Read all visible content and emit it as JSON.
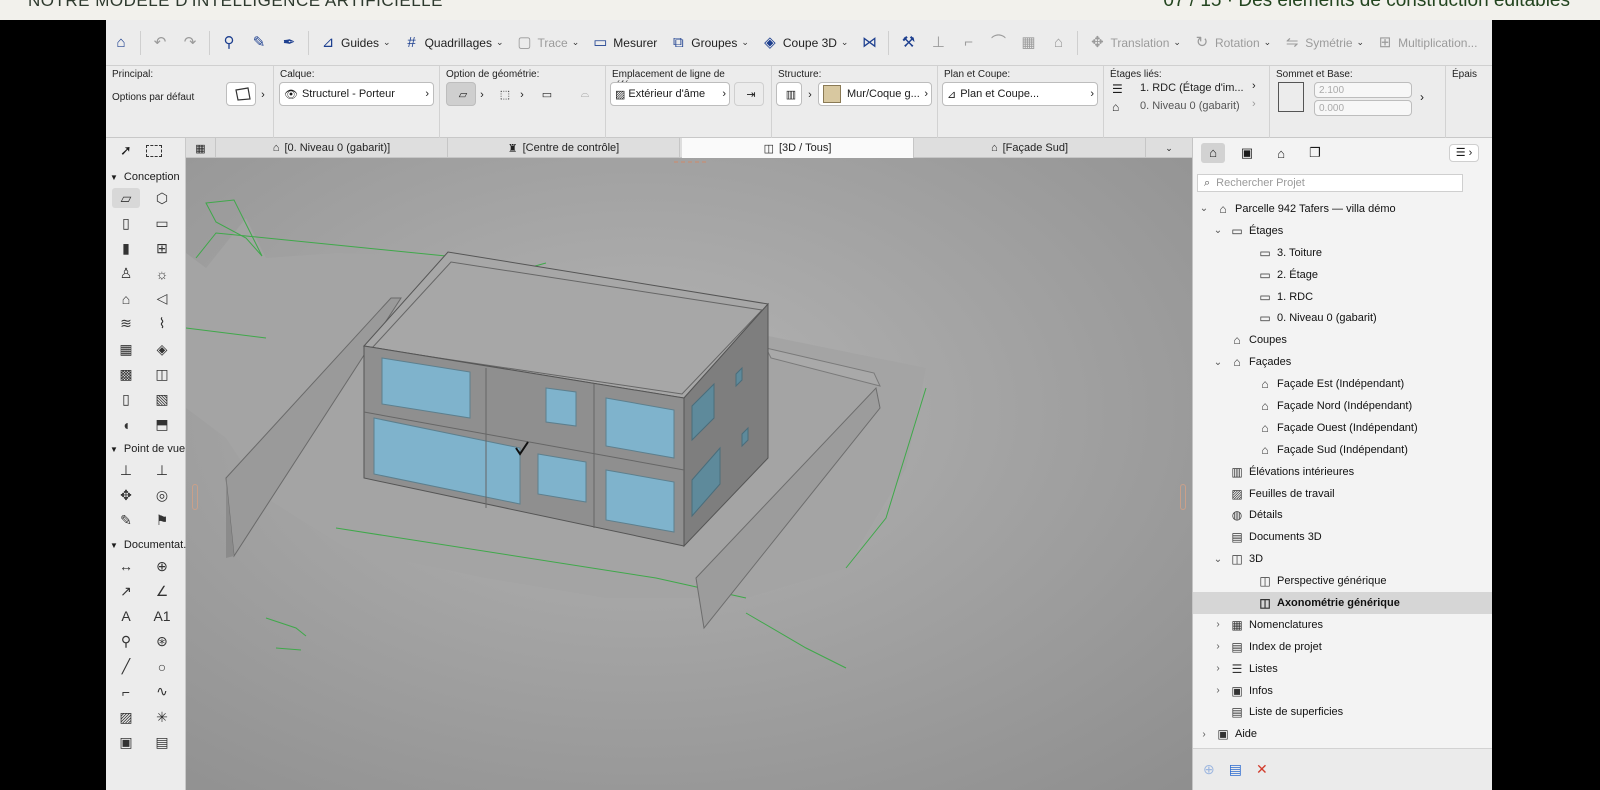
{
  "slide_header": {
    "left_text": "NOTRE MODÈLE D'INTELLIGENCE ARTIFICIELLE",
    "right_text": "07 / 15 · Des éléments de construction éditables"
  },
  "toolbar": {
    "items": [
      {
        "icon": "home-icon",
        "label": ""
      },
      {
        "icon": "undo-icon",
        "label": "",
        "dim": true
      },
      {
        "icon": "redo-icon",
        "label": "",
        "dim": true
      },
      {
        "icon": "inject-icon",
        "label": ""
      },
      {
        "icon": "pipette-icon",
        "label": ""
      },
      {
        "icon": "syringe-icon",
        "label": ""
      },
      {
        "icon": "guides-icon",
        "label": "Guides",
        "caret": true
      },
      {
        "icon": "grid-icon",
        "label": "Quadrillages",
        "caret": true
      },
      {
        "icon": "trace-icon",
        "label": "Trace",
        "caret": true,
        "dim": true
      },
      {
        "icon": "ruler-icon",
        "label": "Mesurer"
      },
      {
        "icon": "groups-icon",
        "label": "Groupes",
        "caret": true
      },
      {
        "icon": "cut3d-icon",
        "label": "Coupe 3D",
        "caret": true
      },
      {
        "icon": "split-icon",
        "label": ""
      },
      {
        "icon": "hammer-icon",
        "label": ""
      },
      {
        "icon": "adjust-icon",
        "label": "",
        "dim": true
      },
      {
        "icon": "intersect-icon",
        "label": "",
        "dim": true
      },
      {
        "icon": "fillet-icon",
        "label": "",
        "dim": true
      },
      {
        "icon": "explode-icon",
        "label": "",
        "dim": true
      },
      {
        "icon": "roof-icon",
        "label": "",
        "dim": true
      },
      {
        "icon": "translation-icon",
        "label": "Translation",
        "caret": true,
        "dim": true
      },
      {
        "icon": "rotation-icon",
        "label": "Rotation",
        "caret": true,
        "dim": true
      },
      {
        "icon": "mirror-icon",
        "label": "Symétrie",
        "caret": true,
        "dim": true
      },
      {
        "icon": "multiply-icon",
        "label": "Multiplication...",
        "dim": true
      }
    ]
  },
  "infobox": {
    "principal": {
      "title": "Principal:",
      "value": "Options par défaut"
    },
    "calque": {
      "title": "Calque:",
      "value": "Structurel - Porteur"
    },
    "geometrie": {
      "title": "Option de géométrie:"
    },
    "ligne_ref": {
      "title": "Emplacement de ligne de référence:",
      "value": "Extérieur d'âme"
    },
    "structure": {
      "title": "Structure:",
      "value": "Mur/Coque g..."
    },
    "plan_coupe": {
      "title": "Plan et Coupe:",
      "value": "Plan et Coupe..."
    },
    "etages": {
      "title": "Étages liés:",
      "top": "1. RDC (Étage d'im...",
      "bottom": "0. Niveau 0 (gabarit)"
    },
    "sommet": {
      "title": "Sommet et Base:",
      "top": "2.100",
      "bottom": "0.000"
    },
    "epaisseur": {
      "title": "Épais"
    }
  },
  "tabs": [
    {
      "icon": "floorplan-icon",
      "label": "[0. Niveau 0 (gabarit)]"
    },
    {
      "icon": "control-center-icon",
      "label": "[Centre de contrôle]"
    },
    {
      "icon": "3d-cube-icon",
      "label": "[3D / Tous]",
      "active": true
    },
    {
      "icon": "elevation-icon",
      "label": "[Façade Sud]"
    }
  ],
  "toolbox": {
    "sections": [
      {
        "label": "Conception"
      },
      {
        "label": "Point de vue"
      },
      {
        "label": "Documentat."
      }
    ]
  },
  "navigator": {
    "search_placeholder": "Rechercher Projet",
    "tree": [
      {
        "label": "Parcelle 942 Tafers — villa démo",
        "level": 0,
        "tw": "v",
        "icon": "house-icon"
      },
      {
        "label": "Étages",
        "level": 1,
        "tw": "v",
        "icon": "stories-icon"
      },
      {
        "label": "3. Toiture",
        "level": 2,
        "tw": "",
        "icon": "story-icon"
      },
      {
        "label": "2. Étage",
        "level": 2,
        "tw": "",
        "icon": "story-icon"
      },
      {
        "label": "1. RDC",
        "level": 2,
        "tw": "",
        "icon": "story-icon"
      },
      {
        "label": "0. Niveau 0 (gabarit)",
        "level": 2,
        "tw": "",
        "icon": "story-icon"
      },
      {
        "label": "Coupes",
        "level": 1,
        "tw": "",
        "icon": "section-icon"
      },
      {
        "label": "Façades",
        "level": 1,
        "tw": "v",
        "icon": "elevation-icon"
      },
      {
        "label": "Façade Est (Indépendant)",
        "level": 2,
        "tw": "",
        "icon": "elevation-icon"
      },
      {
        "label": "Façade Nord (Indépendant)",
        "level": 2,
        "tw": "",
        "icon": "elevation-icon"
      },
      {
        "label": "Façade Ouest (Indépendant)",
        "level": 2,
        "tw": "",
        "icon": "elevation-icon"
      },
      {
        "label": "Façade Sud (Indépendant)",
        "level": 2,
        "tw": "",
        "icon": "elevation-icon"
      },
      {
        "label": "Élévations intérieures",
        "level": 1,
        "tw": "",
        "icon": "interior-elevation-icon"
      },
      {
        "label": "Feuilles de travail",
        "level": 1,
        "tw": "",
        "icon": "worksheet-icon"
      },
      {
        "label": "Détails",
        "level": 1,
        "tw": "",
        "icon": "detail-icon"
      },
      {
        "label": "Documents 3D",
        "level": 1,
        "tw": "",
        "icon": "document-3d-icon"
      },
      {
        "label": "3D",
        "level": 1,
        "tw": "v",
        "icon": "3d-icon"
      },
      {
        "label": "Perspective générique",
        "level": 2,
        "tw": "",
        "icon": "perspective-icon"
      },
      {
        "label": "Axonométrie générique",
        "level": 2,
        "tw": "",
        "icon": "axonometry-icon",
        "selected": true
      },
      {
        "label": "Nomenclatures",
        "level": 1,
        "tw": ">",
        "icon": "schedule-icon"
      },
      {
        "label": "Index de projet",
        "level": 1,
        "tw": ">",
        "icon": "index-icon"
      },
      {
        "label": "Listes",
        "level": 1,
        "tw": ">",
        "icon": "list-icon"
      },
      {
        "label": "Infos",
        "level": 1,
        "tw": ">",
        "icon": "info-icon"
      },
      {
        "label": "Liste de superficies",
        "level": 1,
        "tw": "",
        "icon": "area-list-icon"
      },
      {
        "label": "Aide",
        "level": 0,
        "tw": ">",
        "icon": "help-icon"
      }
    ]
  },
  "colors": {
    "viewport_bg": "#9e9e9e",
    "window_glass": "#7fb3cc",
    "terrain_edge": "#3fa84a",
    "selection_bg": "#d6d6d6"
  }
}
